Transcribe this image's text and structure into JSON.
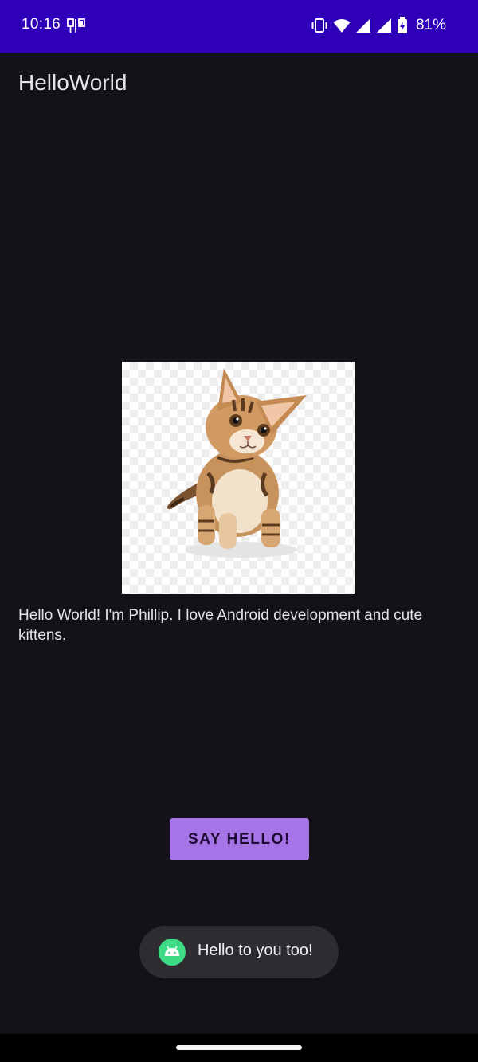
{
  "status_bar": {
    "time": "10:16",
    "battery_percent": "81%",
    "icons": [
      "gallery-status-icon",
      "vibrate-icon",
      "wifi-icon",
      "signal-icon",
      "signal-icon-2",
      "battery-charging-icon"
    ]
  },
  "app_bar": {
    "title": "HelloWorld"
  },
  "main": {
    "image_icon": "kitten-image",
    "greeting": "Hello World! I'm Phillip. I love Android development and cute kittens.",
    "button_label": "SAY HELLO!"
  },
  "toast": {
    "message": "Hello to you too!",
    "icon": "android-icon"
  },
  "colors": {
    "status_bar": "#2f00b8",
    "background": "#141218",
    "button": "#a574e6",
    "toast_bg": "#2d2c31",
    "android_green": "#3ddc84"
  }
}
